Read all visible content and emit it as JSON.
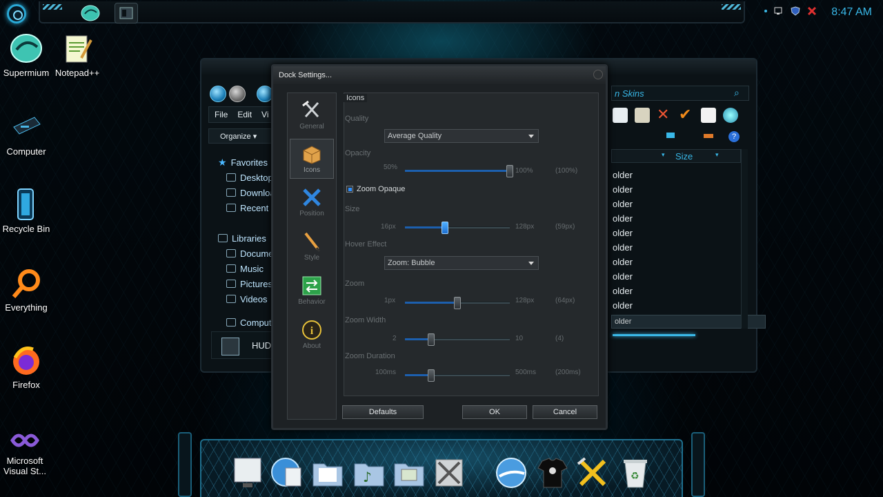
{
  "taskbar": {
    "clock": "8:47 AM",
    "apps": [
      "supermium-taskbar-icon",
      "explorer-taskbar-icon"
    ],
    "tray_icons": [
      "network-icon",
      "shield-icon",
      "flag-icon"
    ]
  },
  "desktop_icons": [
    {
      "label": "Supermium",
      "icon": "supermium-icon"
    },
    {
      "label": "Notepad++",
      "icon": "notepad-plus-plus-icon"
    },
    {
      "label": "Computer",
      "icon": "computer-icon"
    },
    {
      "label": "Recycle Bin",
      "icon": "recycle-bin-icon"
    },
    {
      "label": "Everything",
      "icon": "everything-search-icon"
    },
    {
      "label": "Firefox",
      "icon": "firefox-icon"
    },
    {
      "label": "Microsoft Visual St...",
      "icon": "visual-studio-icon"
    }
  ],
  "explorer": {
    "search_text": "n Skins",
    "menu": [
      "File",
      "Edit",
      "Vi"
    ],
    "organize": "Organize ▾",
    "nav": [
      {
        "label": "Favorites",
        "icon": "star-icon"
      },
      {
        "label": "Desktop",
        "icon": "desktop-icon"
      },
      {
        "label": "Downloads",
        "icon": "downloads-icon"
      },
      {
        "label": "Recent",
        "icon": "recent-icon"
      },
      {
        "label": "Libraries",
        "icon": "libraries-icon"
      },
      {
        "label": "Documents",
        "icon": "documents-icon"
      },
      {
        "label": "Music",
        "icon": "music-icon"
      },
      {
        "label": "Pictures",
        "icon": "pictures-icon"
      },
      {
        "label": "Videos",
        "icon": "videos-icon"
      },
      {
        "label": "Computer",
        "icon": "computer-icon"
      }
    ],
    "column_size": "Size",
    "rows": [
      "older",
      "older",
      "older",
      "older",
      "older",
      "older",
      "older",
      "older",
      "older",
      "older",
      "older"
    ],
    "status_item": "HUD_"
  },
  "dialog": {
    "title": "Dock Settings...",
    "categories": [
      {
        "label": "General",
        "icon": "tools-icon"
      },
      {
        "label": "Icons",
        "icon": "box-icon"
      },
      {
        "label": "Position",
        "icon": "position-arrows-icon"
      },
      {
        "label": "Style",
        "icon": "pencil-icon"
      },
      {
        "label": "Behavior",
        "icon": "behavior-arrows-icon"
      },
      {
        "label": "About",
        "icon": "info-icon"
      }
    ],
    "group_label": "Icons",
    "quality": {
      "label": "Quality",
      "value": "Average Quality"
    },
    "opacity": {
      "label": "Opacity",
      "min": "50%",
      "max": "100%",
      "current": "(100%)",
      "fraction": 1.0
    },
    "zoom_opaque": {
      "label": "Zoom Opaque",
      "checked": true
    },
    "size": {
      "label": "Size",
      "min": "16px",
      "max": "128px",
      "current": "(59px)",
      "fraction": 0.38
    },
    "hover_effect": {
      "label": "Hover Effect",
      "value": "Zoom: Bubble"
    },
    "zoom": {
      "label": "Zoom",
      "min": "1px",
      "max": "128px",
      "current": "(64px)",
      "fraction": 0.5
    },
    "zoom_width": {
      "label": "Zoom Width",
      "min": "2",
      "max": "10",
      "current": "(4)",
      "fraction": 0.25
    },
    "zoom_duration": {
      "label": "Zoom Duration",
      "min": "100ms",
      "max": "500ms",
      "current": "(200ms)",
      "fraction": 0.25
    },
    "buttons": {
      "defaults": "Defaults",
      "ok": "OK",
      "cancel": "Cancel"
    }
  },
  "dock_items": [
    "system-properties-icon",
    "internet-icon",
    "documents-folder-icon",
    "music-folder-icon",
    "pictures-folder-icon",
    "tools-icon",
    "network-globe-icon",
    "tshirt-icon",
    "settings-tools-icon",
    "recycle-bin-icon"
  ]
}
